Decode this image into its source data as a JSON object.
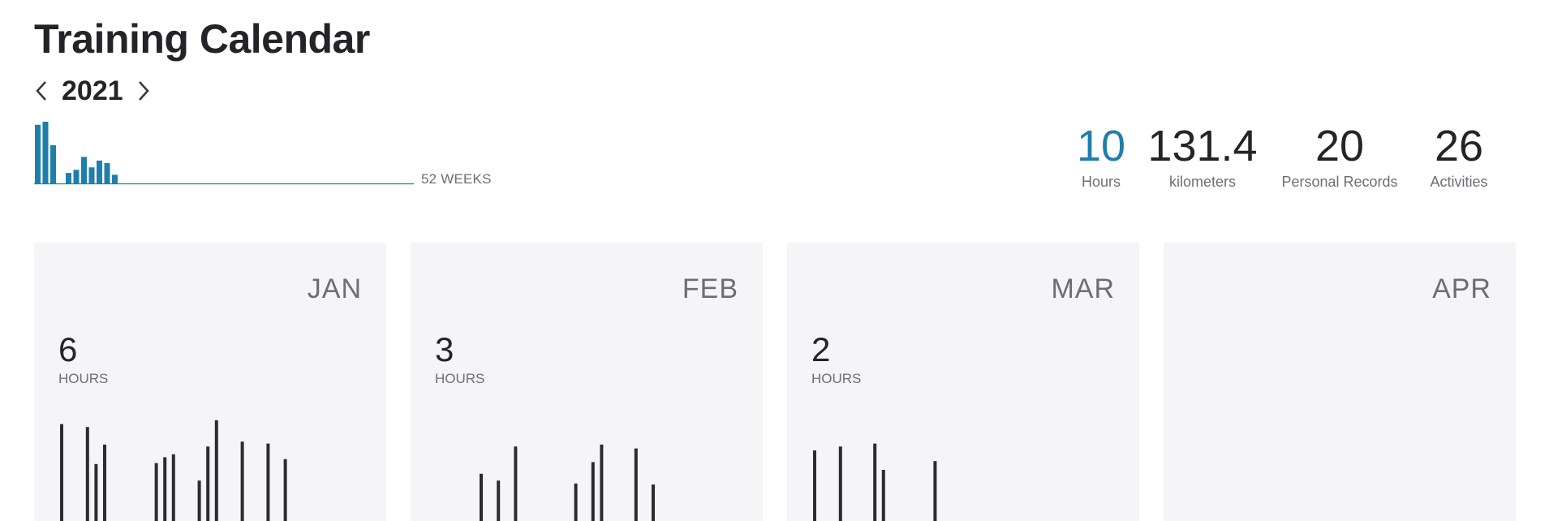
{
  "page": {
    "title": "Training Calendar"
  },
  "year_nav": {
    "year": "2021",
    "prev_icon": "chevron-left-icon",
    "next_icon": "chevron-right-icon"
  },
  "weekly": {
    "weeks_label": "52 WEEKS",
    "color": "#1f7fab",
    "values": [
      0.95,
      1.0,
      0.62,
      0,
      0.17,
      0.22,
      0.43,
      0.26,
      0.37,
      0.33,
      0.14
    ]
  },
  "stats": [
    {
      "value": "10",
      "label": "Hours",
      "accent": true
    },
    {
      "value": "131.4",
      "label": "kilometers",
      "accent": false
    },
    {
      "value": "20",
      "label": "Personal Records",
      "accent": false
    },
    {
      "value": "26",
      "label": "Activities",
      "accent": false
    }
  ],
  "months": [
    {
      "name": "JAN",
      "hours": "6",
      "hours_label": "HOURS",
      "bars": [
        0.77,
        0,
        0,
        0.74,
        0.36,
        0.56,
        0,
        0,
        0,
        0,
        0,
        0.37,
        0.43,
        0.46,
        0,
        0,
        0.19,
        0.54,
        0.81,
        0,
        0,
        0.59,
        0,
        0,
        0.57,
        0,
        0.41
      ]
    },
    {
      "name": "FEB",
      "hours": "3",
      "hours_label": "HOURS",
      "bars": [
        0,
        0,
        0,
        0,
        0,
        0.26,
        0,
        0.19,
        0,
        0.54,
        0,
        0,
        0,
        0,
        0,
        0,
        0.16,
        0,
        0.38,
        0.56,
        0,
        0,
        0,
        0.52,
        0,
        0.15
      ]
    },
    {
      "name": "MAR",
      "hours": "2",
      "hours_label": "HOURS",
      "bars": [
        0.5,
        0,
        0,
        0.54,
        0,
        0,
        0,
        0.57,
        0.3,
        0,
        0,
        0,
        0,
        0,
        0.39
      ]
    },
    {
      "name": "APR",
      "hours": "",
      "hours_label": "",
      "bars": []
    }
  ]
}
